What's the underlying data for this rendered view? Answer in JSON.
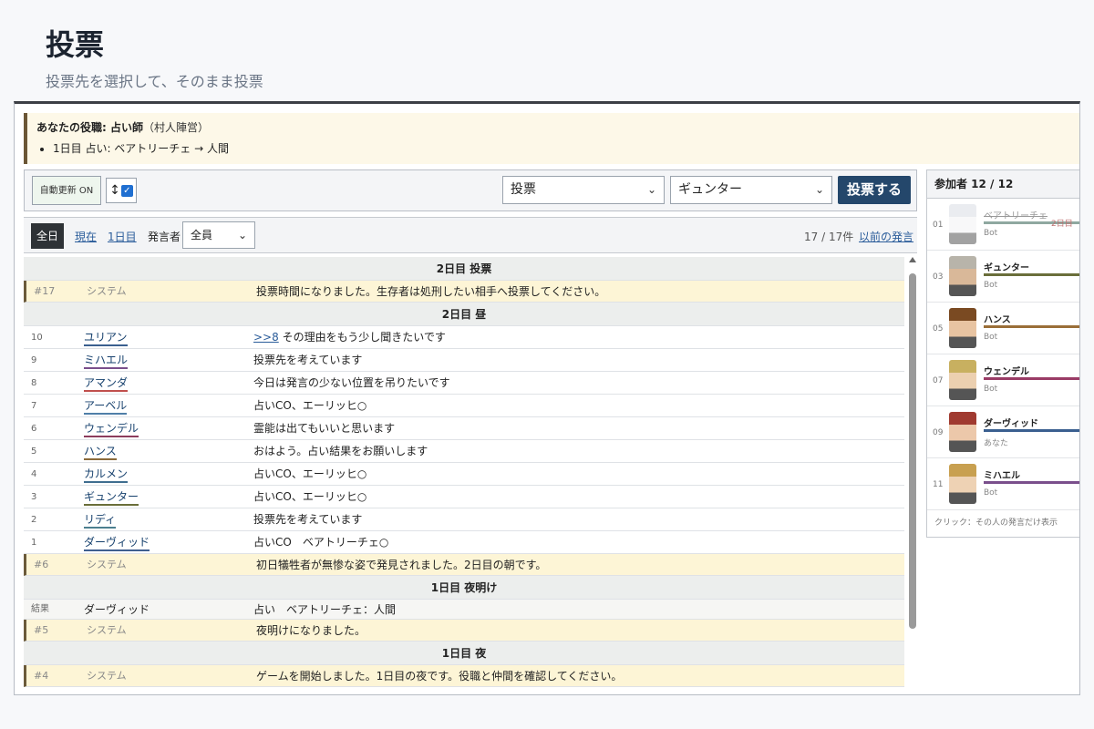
{
  "page": {
    "title": "投票",
    "subtitle": "投票先を選択して、そのまま投票"
  },
  "role": {
    "label": "あなたの役職: 占い師",
    "team": "（村人陣営）",
    "results": [
      "1日目 占い: ベアトリーチェ → 人間"
    ]
  },
  "controls": {
    "auto_update": "自動更新 ON",
    "scroll_icon": "↕",
    "action_select": "投票",
    "target_select": "ギュンター",
    "vote_button": "投票する"
  },
  "filter": {
    "all": "全日",
    "now": "現在",
    "day1": "1日目",
    "speaker_label": "発言者",
    "speaker_select": "全員",
    "count": "17 / 17件",
    "older": "以前の発言"
  },
  "log": [
    {
      "kind": "header",
      "text": "2日目 投票"
    },
    {
      "kind": "sys",
      "no": "#17",
      "name": "システム",
      "text": "投票時間になりました。生存者は処刑したい相手へ投票してください。"
    },
    {
      "kind": "header",
      "text": "2日目 昼"
    },
    {
      "kind": "msg",
      "no": "10",
      "name": "ユリアン",
      "color": "#3a5f8f",
      "reply": ">>8",
      "text": " その理由をもう少し聞きたいです"
    },
    {
      "kind": "msg",
      "no": "9",
      "name": "ミハエル",
      "color": "#7a4f8c",
      "text": "投票先を考えています"
    },
    {
      "kind": "msg",
      "no": "8",
      "name": "アマンダ",
      "color": "#c0504d",
      "text": "今日は発言の少ない位置を吊りたいです"
    },
    {
      "kind": "msg",
      "no": "7",
      "name": "アーベル",
      "color": "#4f7fa8",
      "text": "占いCO、エーリッヒ○"
    },
    {
      "kind": "msg",
      "no": "6",
      "name": "ウェンデル",
      "color": "#8c3c5c",
      "text": "霊能は出てもいいと思います"
    },
    {
      "kind": "msg",
      "no": "5",
      "name": "ハンス",
      "color": "#8a6a3a",
      "text": "おはよう。占い結果をお願いします"
    },
    {
      "kind": "msg",
      "no": "4",
      "name": "カルメン",
      "color": "#3f6e8f",
      "text": "占いCO、エーリッヒ○"
    },
    {
      "kind": "msg",
      "no": "3",
      "name": "ギュンター",
      "color": "#6a6e3a",
      "text": "占いCO、エーリッヒ○"
    },
    {
      "kind": "msg",
      "no": "2",
      "name": "リディ",
      "color": "#4c7f8f",
      "text": "投票先を考えています"
    },
    {
      "kind": "msg",
      "no": "1",
      "name": "ダーヴィッド",
      "color": "#3f5f8f",
      "text": "占いCO　ベアトリーチェ○"
    },
    {
      "kind": "sys",
      "no": "#6",
      "name": "システム",
      "text": "初日犠牲者が無惨な姿で発見されました。2日目の朝です。"
    },
    {
      "kind": "header",
      "text": "1日目 夜明け"
    },
    {
      "kind": "result",
      "no": "結果",
      "name": "ダーヴィッド",
      "text": "占い　ベアトリーチェ：人間"
    },
    {
      "kind": "sys",
      "no": "#5",
      "name": "システム",
      "text": "夜明けになりました。"
    },
    {
      "kind": "header",
      "text": "1日目 夜"
    },
    {
      "kind": "sys",
      "no": "#4",
      "name": "システム",
      "text": "ゲームを開始しました。1日目の夜です。役職と仲間を確認してください。"
    }
  ],
  "participants": {
    "header": "参加者 12 / 12",
    "footer": "クリック：その人の発言だけ表示",
    "items": [
      {
        "no": "01",
        "name": "ベアトリーチェ",
        "sub": "Bot",
        "dead": true,
        "died": "2日目",
        "bar": "#8fa8a0",
        "hair": "#d8dce4",
        "skin": "#f2f2f4"
      },
      {
        "no": "03",
        "name": "ギュンター",
        "sub": "Bot",
        "dead": false,
        "bar": "#6a6e3a",
        "hair": "#b8b4aa",
        "skin": "#d9b899"
      },
      {
        "no": "05",
        "name": "ハンス",
        "sub": "Bot",
        "dead": false,
        "bar": "#9a6e38",
        "hair": "#7a4a22",
        "skin": "#e8c4a2"
      },
      {
        "no": "07",
        "name": "ウェンデル",
        "sub": "Bot",
        "dead": false,
        "bar": "#9a3c66",
        "hair": "#c8b060",
        "skin": "#ecd0b0"
      },
      {
        "no": "09",
        "name": "ダーヴィッド",
        "sub": "あなた",
        "dead": false,
        "bar": "#3a5f8f",
        "hair": "#a03a30",
        "skin": "#ecc8aa"
      },
      {
        "no": "11",
        "name": "ミハエル",
        "sub": "Bot",
        "dead": false,
        "bar": "#7a4f8c",
        "hair": "#c8a050",
        "skin": "#eed2b4"
      }
    ]
  }
}
